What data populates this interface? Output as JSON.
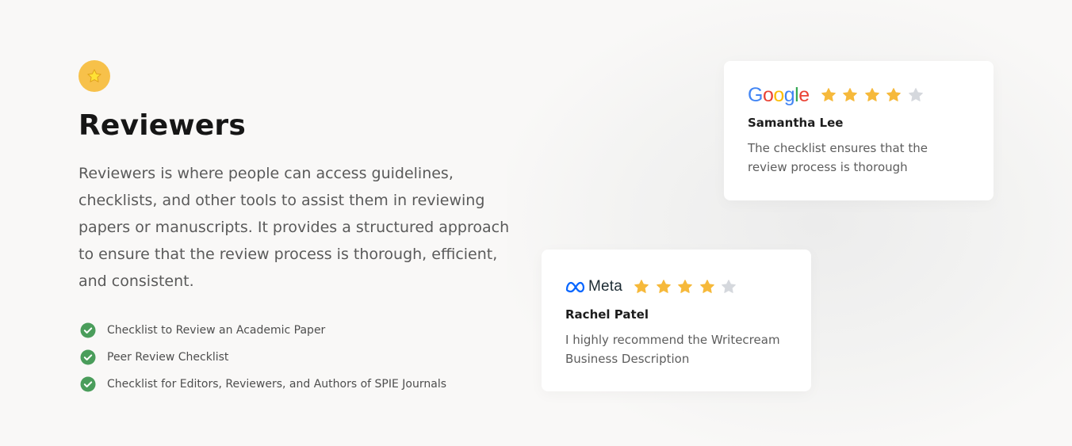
{
  "section": {
    "badge_icon": "star-icon",
    "title": "Reviewers",
    "description": "Reviewers is where people can access guidelines, checklists, and other tools to assist them in reviewing papers or manuscripts. It provides a structured approach to ensure that the review process is thorough, efficient, and consistent.",
    "checklist": [
      "Checklist to Review an Academic Paper",
      "Peer Review Checklist",
      "Checklist for Editors, Reviewers, and Authors of SPIE Journals"
    ]
  },
  "reviews": [
    {
      "company": "Google",
      "rating": 4,
      "max_rating": 5,
      "name": "Samantha Lee",
      "text": "The checklist ensures that the review process is thorough"
    },
    {
      "company": "Meta",
      "rating": 4,
      "max_rating": 5,
      "name": "Rachel Patel",
      "text": "I highly recommend the Writecream Business Description"
    }
  ],
  "colors": {
    "badge": "#f7c14a",
    "star_filled": "#f6b93b",
    "star_empty": "#d5d8dd",
    "check": "#4a9d5b"
  }
}
